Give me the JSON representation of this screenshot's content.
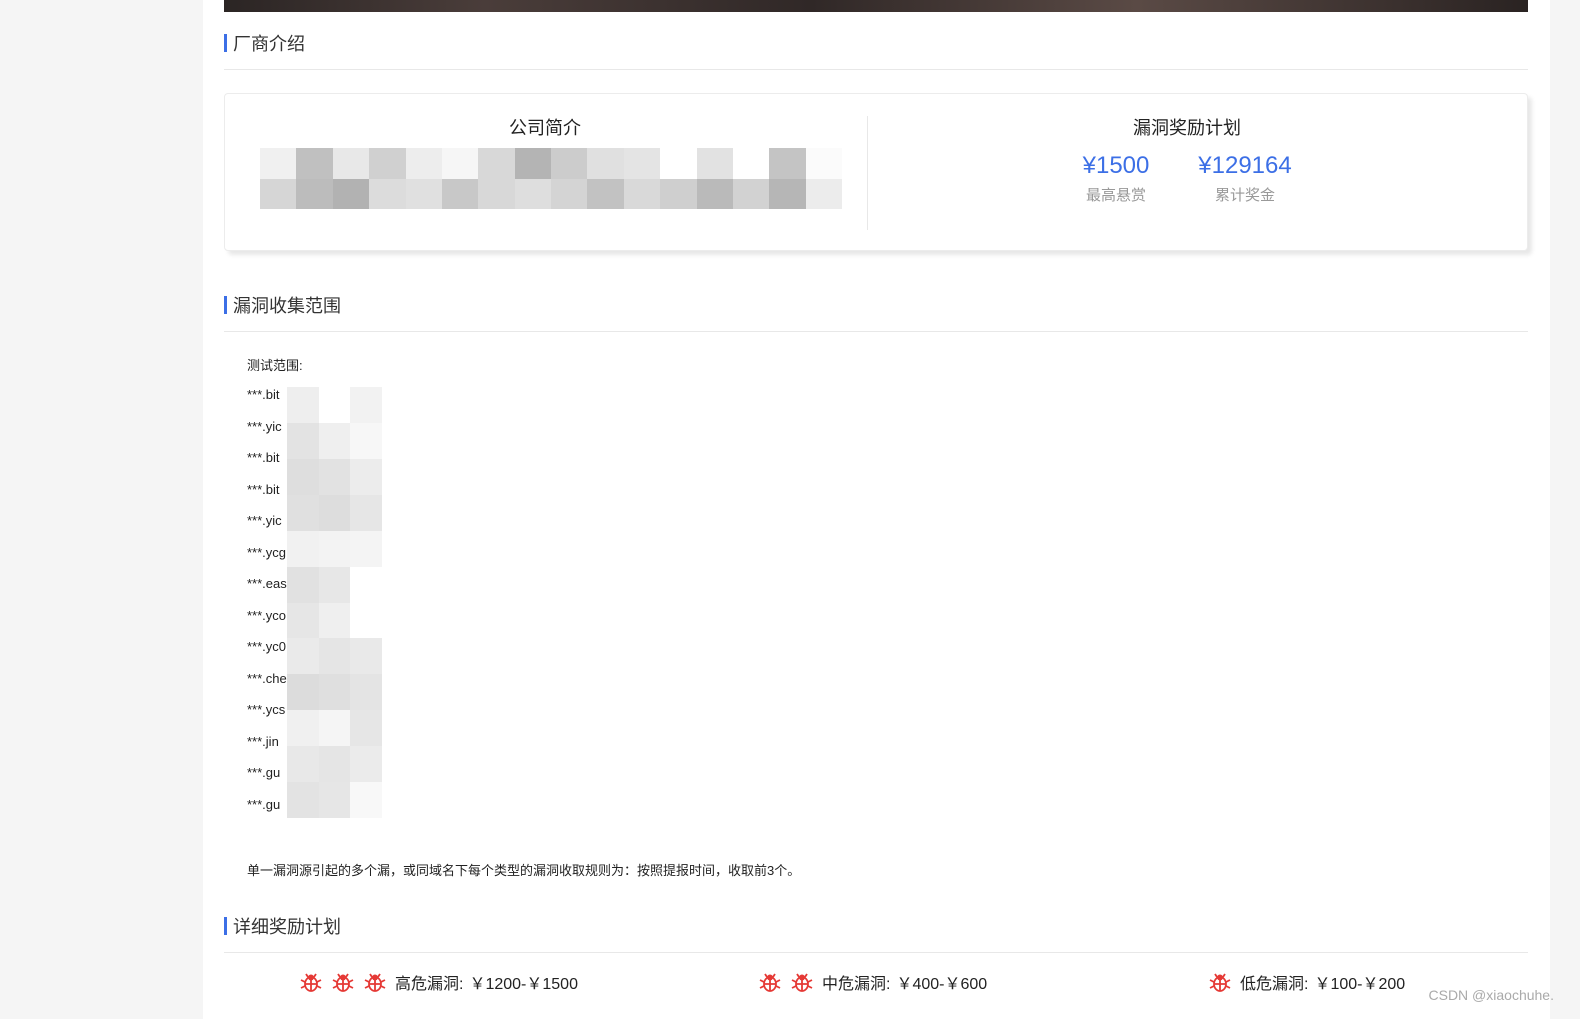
{
  "sections": {
    "vendor_intro": "厂商介绍",
    "scope": "漏洞收集范围",
    "detailed_rewards": "详细奖励计划"
  },
  "card": {
    "company_profile_title": "公司简介",
    "reward_program_title": "漏洞奖励计划",
    "stats": [
      {
        "value": "¥1500",
        "label": "最高悬赏"
      },
      {
        "value": "¥129164",
        "label": "累计奖金"
      }
    ],
    "accent_color": "#3c6fe6"
  },
  "scope": {
    "heading": "测试范围:",
    "items": [
      "***.bit",
      "***.yic",
      "***.bit",
      "***.bit",
      "***.yic",
      "***.ycg",
      "***.eas",
      "***.yco",
      "***.yc0",
      "***.che",
      "***.ycs",
      "***.jin",
      "***.gu",
      "***.gu"
    ],
    "note": "单一漏洞源引起的多个漏，或同域名下每个类型的漏洞收取规则为：按照提报时间，收取前3个。"
  },
  "rewards": [
    {
      "level": "高危漏洞:",
      "range": "￥1200-￥1500",
      "bugs": 3
    },
    {
      "level": "中危漏洞:",
      "range": "￥400-￥600",
      "bugs": 2
    },
    {
      "level": "低危漏洞:",
      "range": "￥100-￥200",
      "bugs": 1
    }
  ],
  "bug_color": "#e53935",
  "watermark": "CSDN @xiaochuhe."
}
